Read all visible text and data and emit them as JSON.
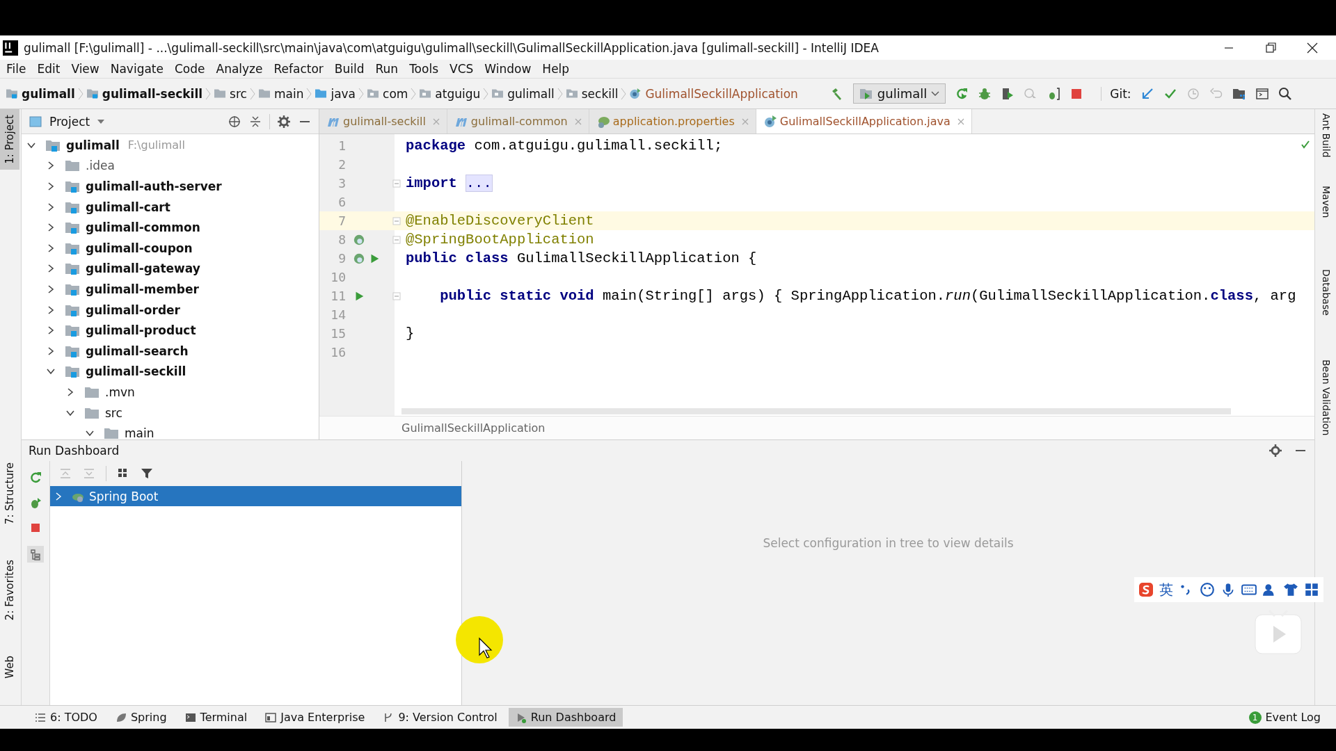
{
  "window": {
    "title": "gulimall [F:\\gulimall] - ...\\gulimall-seckill\\src\\main\\java\\com\\atguigu\\gulimall\\seckill\\GulimallSeckillApplication.java [gulimall-seckill] - IntelliJ IDEA"
  },
  "menu": [
    "File",
    "Edit",
    "View",
    "Navigate",
    "Code",
    "Analyze",
    "Refactor",
    "Build",
    "Run",
    "Tools",
    "VCS",
    "Window",
    "Help"
  ],
  "breadcrumbs": [
    {
      "label": "gulimall",
      "kind": "module"
    },
    {
      "label": "gulimall-seckill",
      "kind": "module"
    },
    {
      "label": "src",
      "kind": "folder"
    },
    {
      "label": "main",
      "kind": "folder"
    },
    {
      "label": "java",
      "kind": "source"
    },
    {
      "label": "com",
      "kind": "package"
    },
    {
      "label": "atguigu",
      "kind": "package"
    },
    {
      "label": "gulimall",
      "kind": "package"
    },
    {
      "label": "seckill",
      "kind": "package"
    },
    {
      "label": "GulimallSeckillApplication",
      "kind": "class"
    }
  ],
  "run_config": {
    "label": "gulimall"
  },
  "vcs_label": "Git:",
  "left_stripe": [
    {
      "label": "1: Project",
      "selected": true
    },
    {
      "label": "7: Structure",
      "selected": false
    },
    {
      "label": "2: Favorites",
      "selected": false
    },
    {
      "label": "Web",
      "selected": false
    }
  ],
  "right_stripe": [
    {
      "label": "Ant Build"
    },
    {
      "label": "Maven"
    },
    {
      "label": "Database"
    },
    {
      "label": "Bean Validation"
    }
  ],
  "project_panel": {
    "title": "Project",
    "tree": [
      {
        "label": "gulimall",
        "path": "F:\\gulimall",
        "kind": "module",
        "expanded": true,
        "children": [
          {
            "label": ".idea",
            "kind": "folder",
            "expanded": false
          },
          {
            "label": "gulimall-auth-server",
            "kind": "module",
            "expanded": false
          },
          {
            "label": "gulimall-cart",
            "kind": "module",
            "expanded": false
          },
          {
            "label": "gulimall-common",
            "kind": "module",
            "expanded": false
          },
          {
            "label": "gulimall-coupon",
            "kind": "module",
            "expanded": false
          },
          {
            "label": "gulimall-gateway",
            "kind": "module",
            "expanded": false
          },
          {
            "label": "gulimall-member",
            "kind": "module",
            "expanded": false
          },
          {
            "label": "gulimall-order",
            "kind": "module",
            "expanded": false
          },
          {
            "label": "gulimall-product",
            "kind": "module",
            "expanded": false
          },
          {
            "label": "gulimall-search",
            "kind": "module",
            "expanded": false
          },
          {
            "label": "gulimall-seckill",
            "kind": "module",
            "expanded": true,
            "children": [
              {
                "label": ".mvn",
                "kind": "folder",
                "expanded": false
              },
              {
                "label": "src",
                "kind": "folder",
                "expanded": true,
                "children": [
                  {
                    "label": "main",
                    "kind": "folder",
                    "expanded": true
                  }
                ]
              }
            ]
          }
        ]
      }
    ]
  },
  "editor_tabs": [
    {
      "label": "gulimall-seckill",
      "kind": "module",
      "selected": false
    },
    {
      "label": "gulimall-common",
      "kind": "module",
      "selected": false
    },
    {
      "label": "application.properties",
      "kind": "properties",
      "selected": false
    },
    {
      "label": "GulimallSeckillApplication.java",
      "kind": "class",
      "selected": true
    }
  ],
  "code_lines": [
    {
      "number": "1",
      "current": false,
      "fold": false,
      "bean": false,
      "run": false,
      "segments": [
        {
          "text": "package",
          "kind": "keyword"
        },
        {
          "text": " com.atguigu.gulimall.seckill;",
          "kind": "plain"
        }
      ]
    },
    {
      "number": "2",
      "current": false,
      "fold": false,
      "bean": false,
      "run": false
    },
    {
      "number": "3",
      "current": false,
      "fold": true,
      "bean": false,
      "run": false,
      "segments": [
        {
          "text": "import",
          "kind": "keyword"
        },
        {
          "text": "...",
          "kind": "folded"
        }
      ]
    },
    {
      "number": "6",
      "current": false,
      "fold": false,
      "bean": false,
      "run": false
    },
    {
      "number": "7",
      "current": true,
      "fold": true,
      "bean": false,
      "run": false,
      "segments": [
        {
          "text": "@EnableDiscoveryClient",
          "kind": "annotation"
        }
      ]
    },
    {
      "number": "8",
      "current": false,
      "fold": true,
      "bean": true,
      "run": false,
      "segments": [
        {
          "text": "@SpringBootApplication",
          "kind": "annotation"
        }
      ]
    },
    {
      "number": "9",
      "current": false,
      "fold": false,
      "bean": true,
      "run": true,
      "segments": [
        {
          "text": "public class",
          "kind": "keyword"
        },
        {
          "text": " GulimallSeckillApplication {",
          "kind": "plain"
        }
      ]
    },
    {
      "number": "10",
      "current": false,
      "fold": false,
      "bean": false,
      "run": false
    },
    {
      "number": "11",
      "current": false,
      "fold": true,
      "bean": false,
      "run": true,
      "segments": [
        {
          "text": "    public static void",
          "kind": "keyword"
        },
        {
          "text": " main(String[] args) { SpringApplication.",
          "kind": "plain"
        },
        {
          "text": "run",
          "kind": "italic"
        },
        {
          "text": "(GulimallSeckillApplication.",
          "kind": "plain"
        },
        {
          "text": "class",
          "kind": "keyword"
        },
        {
          "text": ", arg",
          "kind": "plain"
        }
      ]
    },
    {
      "number": "14",
      "current": false,
      "fold": false,
      "bean": false,
      "run": false
    },
    {
      "number": "15",
      "current": false,
      "fold": false,
      "bean": false,
      "run": false,
      "segments": [
        {
          "text": "}",
          "kind": "plain"
        }
      ]
    },
    {
      "number": "16",
      "current": false,
      "fold": false,
      "bean": false,
      "run": false
    }
  ],
  "editor_breadcrumb": "GulimallSeckillApplication",
  "run_dashboard": {
    "title": "Run Dashboard",
    "tree": [
      {
        "label": "Spring Boot",
        "selected": true,
        "expanded": false
      }
    ],
    "empty_text": "Select configuration in tree to view details"
  },
  "ime_bar": {
    "label": "英"
  },
  "bottom_tools": [
    {
      "label": "6: TODO",
      "kind": "todo",
      "selected": false
    },
    {
      "label": "Spring",
      "kind": "spring",
      "selected": false
    },
    {
      "label": "Terminal",
      "kind": "terminal",
      "selected": false
    },
    {
      "label": "Java Enterprise",
      "kind": "enterprise",
      "selected": false
    },
    {
      "label": "9: Version Control",
      "kind": "vcs",
      "selected": false
    },
    {
      "label": "Run Dashboard",
      "kind": "run",
      "selected": true
    }
  ],
  "event_log": {
    "label": "Event Log",
    "count": "1"
  }
}
